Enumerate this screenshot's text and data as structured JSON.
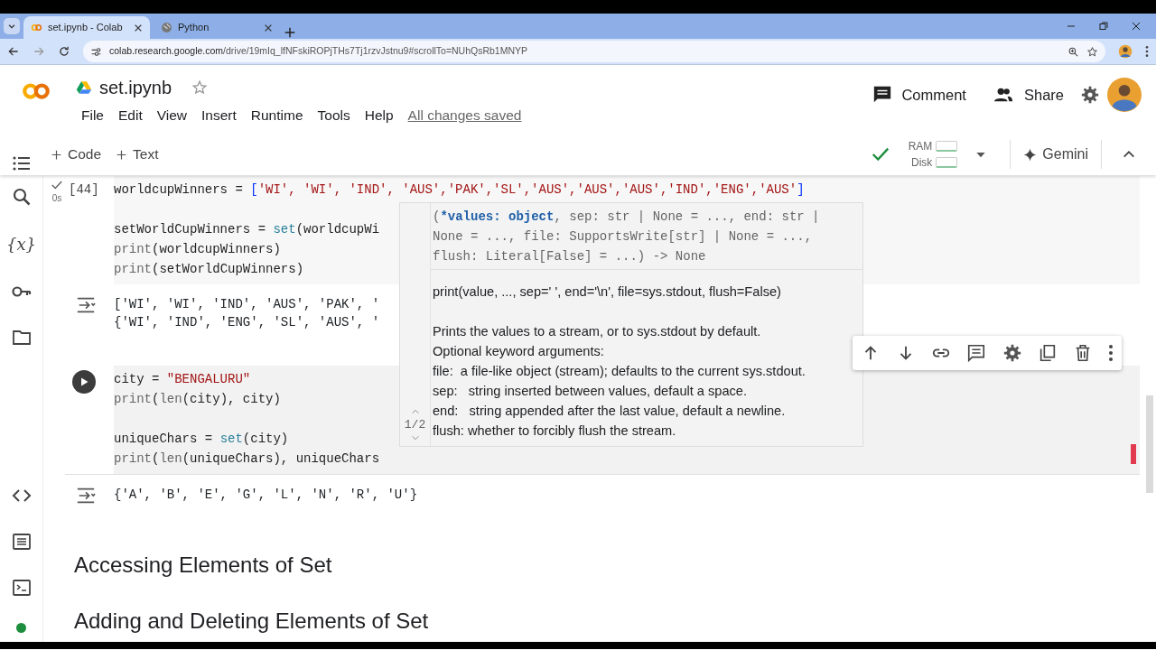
{
  "browser": {
    "tabs": [
      {
        "title": "set.ipynb - Colab",
        "selected": true
      },
      {
        "title": "Python",
        "selected": false
      }
    ],
    "url_domain": "colab.research.google.com",
    "url_path": "/drive/19mIq_lfNFskiROPjTHs7Tj1rzvJstnu9#scrollTo=NUhQsRb1MNYP"
  },
  "header": {
    "title": "set.ipynb",
    "starred": false,
    "menu": [
      "File",
      "Edit",
      "View",
      "Insert",
      "Runtime",
      "Tools",
      "Help"
    ],
    "save_status": "All changes saved",
    "comment": "Comment",
    "share": "Share"
  },
  "toolbar": {
    "add": [
      "Code",
      "Text"
    ],
    "connected": true,
    "ram": "RAM",
    "disk": "Disk",
    "gemini": "Gemini"
  },
  "sidebar": {
    "items": [
      {
        "kind": "toc"
      },
      {
        "kind": "search"
      },
      {
        "kind": "variables",
        "label": "{x}"
      },
      {
        "kind": "key"
      },
      {
        "kind": "folder"
      }
    ],
    "bottom": [
      {
        "kind": "code"
      },
      {
        "kind": "command"
      },
      {
        "kind": "terminal"
      }
    ]
  },
  "cells": [
    {
      "kind": "code",
      "executed": true,
      "exec_count": "[44]",
      "duration": "0s",
      "focused": false,
      "lines": [
        {
          "tokens": [
            {
              "kind": "plain",
              "text": "worldcupWinners = "
            },
            {
              "kind": "bracket",
              "text": "["
            },
            {
              "kind": "str",
              "text": "'WI', 'WI', 'IND', 'AUS','PAK','SL','AUS','AUS','AUS','IND','ENG','AUS'"
            },
            {
              "kind": "bracket",
              "text": "]"
            }
          ]
        },
        {
          "blank_before": true,
          "tokens": [
            {
              "kind": "plain",
              "text": "setWorldCupWinners = "
            },
            {
              "kind": "fn",
              "text": "set"
            },
            {
              "kind": "plain",
              "text": "(worldcupWi"
            }
          ]
        },
        {
          "tokens": [
            {
              "kind": "call",
              "text": "print"
            },
            {
              "kind": "plain",
              "text": "(worldcupWinners)"
            }
          ]
        },
        {
          "tokens": [
            {
              "kind": "call",
              "text": "print"
            },
            {
              "kind": "plain",
              "text": "(setWorldCupWinners)"
            }
          ]
        }
      ],
      "output": [
        "['WI', 'WI', 'IND', 'AUS', 'PAK', '",
        "{'WI', 'IND', 'ENG', 'SL', 'AUS', '"
      ]
    },
    {
      "kind": "code",
      "executed": false,
      "focused": true,
      "lines": [
        {
          "tokens": [
            {
              "kind": "plain",
              "text": "city = "
            },
            {
              "kind": "str",
              "text": "\"BENGALURU\""
            }
          ]
        },
        {
          "tokens": [
            {
              "kind": "call",
              "text": "print"
            },
            {
              "kind": "plain",
              "text": "("
            },
            {
              "kind": "call",
              "text": "len"
            },
            {
              "kind": "plain",
              "text": "(city), city)"
            }
          ]
        },
        {
          "blank_before": true,
          "tokens": [
            {
              "kind": "plain",
              "text": "uniqueChars = "
            },
            {
              "kind": "fn",
              "text": "set"
            },
            {
              "kind": "plain",
              "text": "(city)"
            }
          ]
        },
        {
          "tokens": [
            {
              "kind": "call",
              "text": "print"
            },
            {
              "kind": "plain",
              "text": "("
            },
            {
              "kind": "call",
              "text": "len"
            },
            {
              "kind": "plain",
              "text": "(uniqueChars), uniqueChars"
            }
          ]
        }
      ],
      "output": [
        "{'A', 'B', 'E', 'G', 'L', 'N', 'R', 'U'}"
      ]
    },
    {
      "kind": "heading",
      "text": "Accessing Elements of Set"
    },
    {
      "kind": "heading",
      "text": "Adding and Deleting Elements of Set"
    }
  ],
  "tooltip": {
    "signature": [
      [
        {
          "kind": "plain",
          "text": "("
        },
        {
          "kind": "active",
          "text": "*values: object"
        },
        {
          "kind": "plain",
          "text": ", sep: str | None = ..., end: str |"
        }
      ],
      [
        {
          "kind": "plain",
          "text": "None = ..., file: SupportsWrite[str] | None = ...,"
        }
      ],
      [
        {
          "kind": "plain",
          "text": "flush: Literal[False] = ...) -> None"
        }
      ]
    ],
    "usage": "print(value, ..., sep=' ', end='\\n', file=sys.stdout, flush=False)",
    "doc": [
      "Prints the values to a stream, or to sys.stdout by default.",
      "Optional keyword arguments:",
      "file:  a file-like object (stream); defaults to the current sys.stdout.",
      "sep:   string inserted between values, default a space.",
      "end:   string appended after the last value, default a newline.",
      "flush: whether to forcibly flush the stream."
    ],
    "pager": "1/2"
  },
  "cell_toolbar": [
    {
      "kind": "up"
    },
    {
      "kind": "down"
    },
    {
      "kind": "link"
    },
    {
      "kind": "comment"
    },
    {
      "kind": "settings"
    },
    {
      "kind": "mirror"
    },
    {
      "kind": "delete"
    },
    {
      "kind": "more"
    }
  ]
}
